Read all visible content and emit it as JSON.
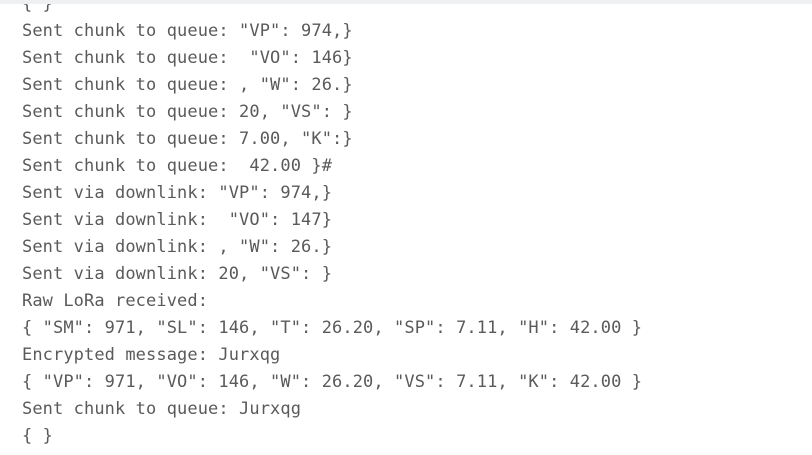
{
  "console": {
    "lines": [
      "{ }",
      "Sent chunk to queue: \"VP\": 974,}",
      "Sent chunk to queue:  \"VO\": 146}",
      "Sent chunk to queue: , \"W\": 26.}",
      "Sent chunk to queue: 20, \"VS\": }",
      "Sent chunk to queue: 7.00, \"K\":}",
      "Sent chunk to queue:  42.00 }#",
      "Sent via downlink: \"VP\": 974,}",
      "Sent via downlink:  \"VO\": 147}",
      "Sent via downlink: , \"W\": 26.}",
      "Sent via downlink: 20, \"VS\": }",
      "Raw LoRa received:",
      "{ \"SM\": 971, \"SL\": 146, \"T\": 26.20, \"SP\": 7.11, \"H\": 42.00 }",
      "Encrypted message: Jurxqg",
      "{ \"VP\": 971, \"VO\": 146, \"W\": 26.20, \"VS\": 7.11, \"K\": 42.00 }",
      "Sent chunk to queue: Jurxqg",
      "{ }"
    ]
  }
}
